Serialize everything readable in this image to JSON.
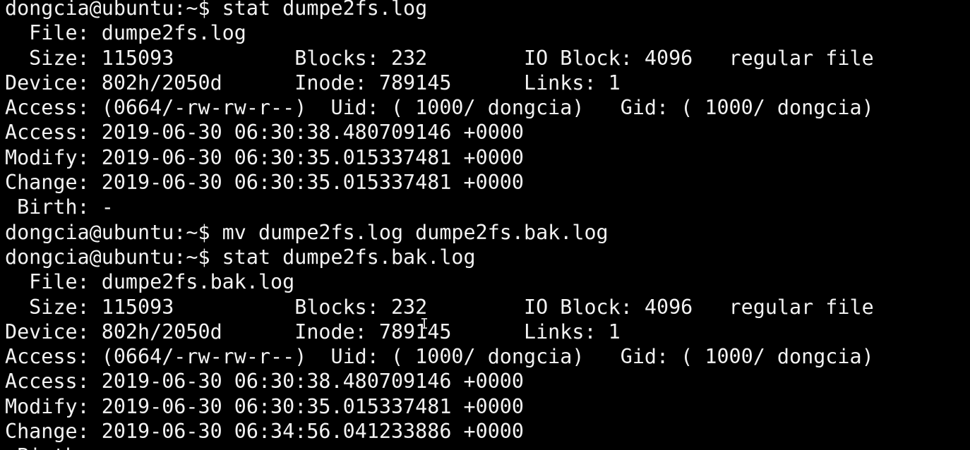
{
  "terminal": {
    "lines": [
      "dongcia@ubuntu:~$ stat dumpe2fs.log",
      "  File: dumpe2fs.log",
      "  Size: 115093          Blocks: 232        IO Block: 4096   regular file",
      "Device: 802h/2050d      Inode: 789145      Links: 1",
      "Access: (0664/-rw-rw-r--)  Uid: ( 1000/ dongcia)   Gid: ( 1000/ dongcia)",
      "Access: 2019-06-30 06:30:38.480709146 +0000",
      "Modify: 2019-06-30 06:30:35.015337481 +0000",
      "Change: 2019-06-30 06:30:35.015337481 +0000",
      " Birth: -",
      "dongcia@ubuntu:~$ mv dumpe2fs.log dumpe2fs.bak.log",
      "dongcia@ubuntu:~$ stat dumpe2fs.bak.log",
      "  File: dumpe2fs.bak.log",
      "  Size: 115093          Blocks: 232        IO Block: 4096   regular file",
      "Device: 802h/2050d      Inode: 789145      Links: 1",
      "Access: (0664/-rw-rw-r--)  Uid: ( 1000/ dongcia)   Gid: ( 1000/ dongcia)",
      "Access: 2019-06-30 06:30:38.480709146 +0000",
      "Modify: 2019-06-30 06:30:35.015337481 +0000",
      "Change: 2019-06-30 06:34:56.041233886 +0000",
      " Birth: -"
    ],
    "background_color": "#000000",
    "text_color": "#f2f2f2"
  },
  "mouse_cursor": {
    "icon": "text-ibeam-cursor",
    "glyph": "I"
  }
}
